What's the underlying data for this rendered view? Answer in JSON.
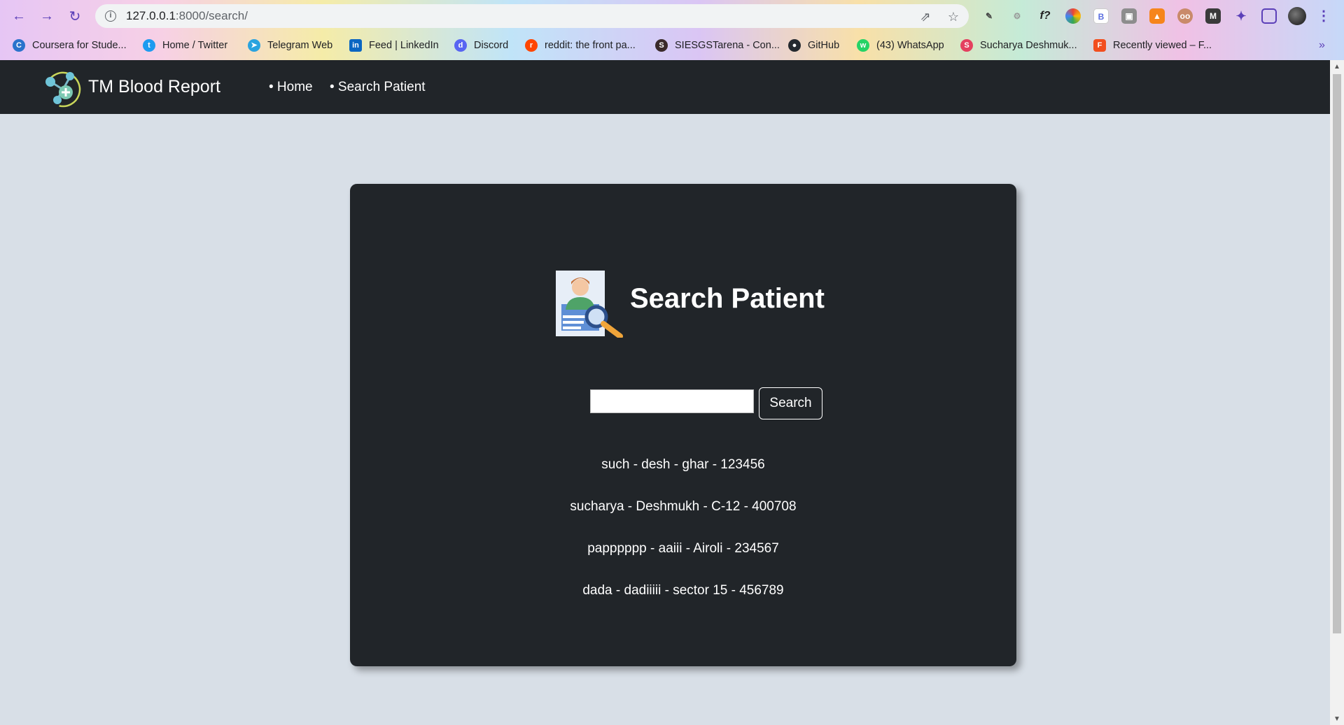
{
  "browser": {
    "url_host": "127.0.0.1",
    "url_path": ":8000/search/",
    "bookmarks": [
      {
        "label": "Coursera for Stude...",
        "icon": "coursera-icon",
        "color": "#2a73cc"
      },
      {
        "label": "Home / Twitter",
        "icon": "twitter-icon",
        "color": "#1d9bf0"
      },
      {
        "label": "Telegram Web",
        "icon": "telegram-icon",
        "color": "#2aa3df"
      },
      {
        "label": "Feed | LinkedIn",
        "icon": "linkedin-icon",
        "color": "#0a66c2"
      },
      {
        "label": "Discord",
        "icon": "discord-icon",
        "color": "#5865f2"
      },
      {
        "label": "reddit: the front pa...",
        "icon": "reddit-icon",
        "color": "#ff4500"
      },
      {
        "label": "SIESGSTarena - Con...",
        "icon": "siesgst-icon",
        "color": "#3a2a2a"
      },
      {
        "label": "GitHub",
        "icon": "github-icon",
        "color": "#24292f"
      },
      {
        "label": "(43) WhatsApp",
        "icon": "whatsapp-icon",
        "color": "#25d366"
      },
      {
        "label": "Sucharya Deshmuk...",
        "icon": "sucharya-icon",
        "color": "#e4405f"
      },
      {
        "label": "Recently viewed – F...",
        "icon": "figma-icon",
        "color": "#f24e1e"
      }
    ],
    "overflow_label": "»"
  },
  "navbar": {
    "brand": "TM Blood Report",
    "links": [
      "• Home",
      "• Search Patient"
    ]
  },
  "search": {
    "title": "Search Patient",
    "button_label": "Search",
    "input_value": "",
    "results": [
      "such - desh - ghar - 123456",
      "sucharya - Deshmukh - C-12 - 400708",
      "papppppp - aaiii - Airoli - 234567",
      "dada - dadiiiii - sector 15 - 456789"
    ]
  }
}
